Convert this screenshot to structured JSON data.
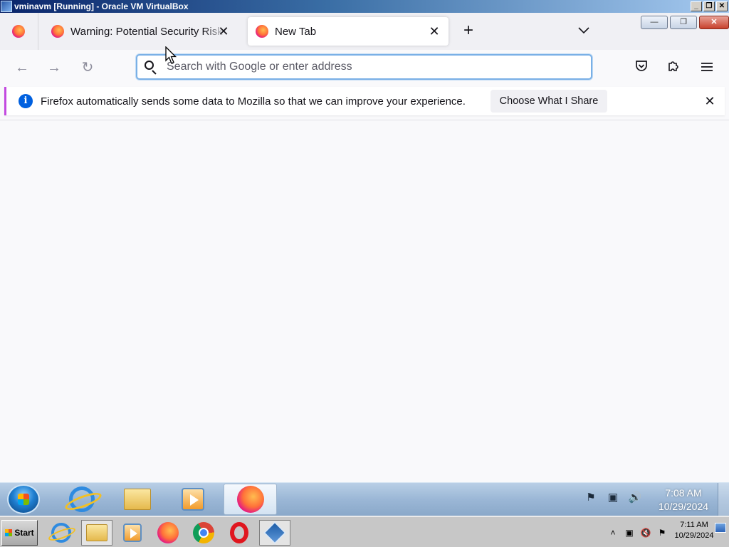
{
  "host_window": {
    "title": "vminavm [Running] - Oracle VM VirtualBox",
    "controls": {
      "minimize": "_",
      "restore": "❐",
      "close": "✕"
    }
  },
  "tabs": {
    "pinned_icon": "firefox-icon",
    "warning_tab": {
      "label": "Warning: Potential Security Risk",
      "icon": "firefox-icon",
      "close": "✕"
    },
    "new_tab": {
      "label": "New Tab",
      "icon": "firefox-icon",
      "close": "✕",
      "selected": true
    },
    "new_tab_button": "+",
    "list_all_tabs": "⌄"
  },
  "window_controls": {
    "minimize": "—",
    "restore": "❐",
    "close": "✕"
  },
  "navbar": {
    "back": "←",
    "forward": "→",
    "reload": "↻",
    "search_placeholder": "Search with Google or enter address",
    "search_value": "",
    "pocket_icon": "pocket-icon",
    "extensions_icon": "puzzle-icon",
    "menu_icon": "hamburger-menu-icon"
  },
  "notification": {
    "info_glyph": "i",
    "message": "Firefox automatically sends some data to Mozilla so that we can improve your experience.",
    "button_label": "Choose What I Share",
    "close": "✕",
    "accent_color": "#c34ae0"
  },
  "guest_taskbar": {
    "pinned": [
      "internet-explorer-icon",
      "windows-explorer-icon",
      "media-player-icon",
      "firefox-icon"
    ],
    "tray_glyphs": [
      "⚑",
      "▣",
      "🔊"
    ],
    "clock_time": "7:08 AM",
    "clock_date": "10/29/2024"
  },
  "host_taskbar": {
    "start_label": "Start",
    "tasks": [
      "internet-explorer-icon",
      "file-explorer-icon",
      "media-icon",
      "firefox-icon",
      "chrome-icon",
      "opera-icon",
      "virtualbox-icon"
    ],
    "tray_glyphs": [
      "˄",
      "▣",
      "🔇",
      "⚑"
    ],
    "clock_time": "7:11 AM",
    "clock_date": "10/29/2024"
  }
}
